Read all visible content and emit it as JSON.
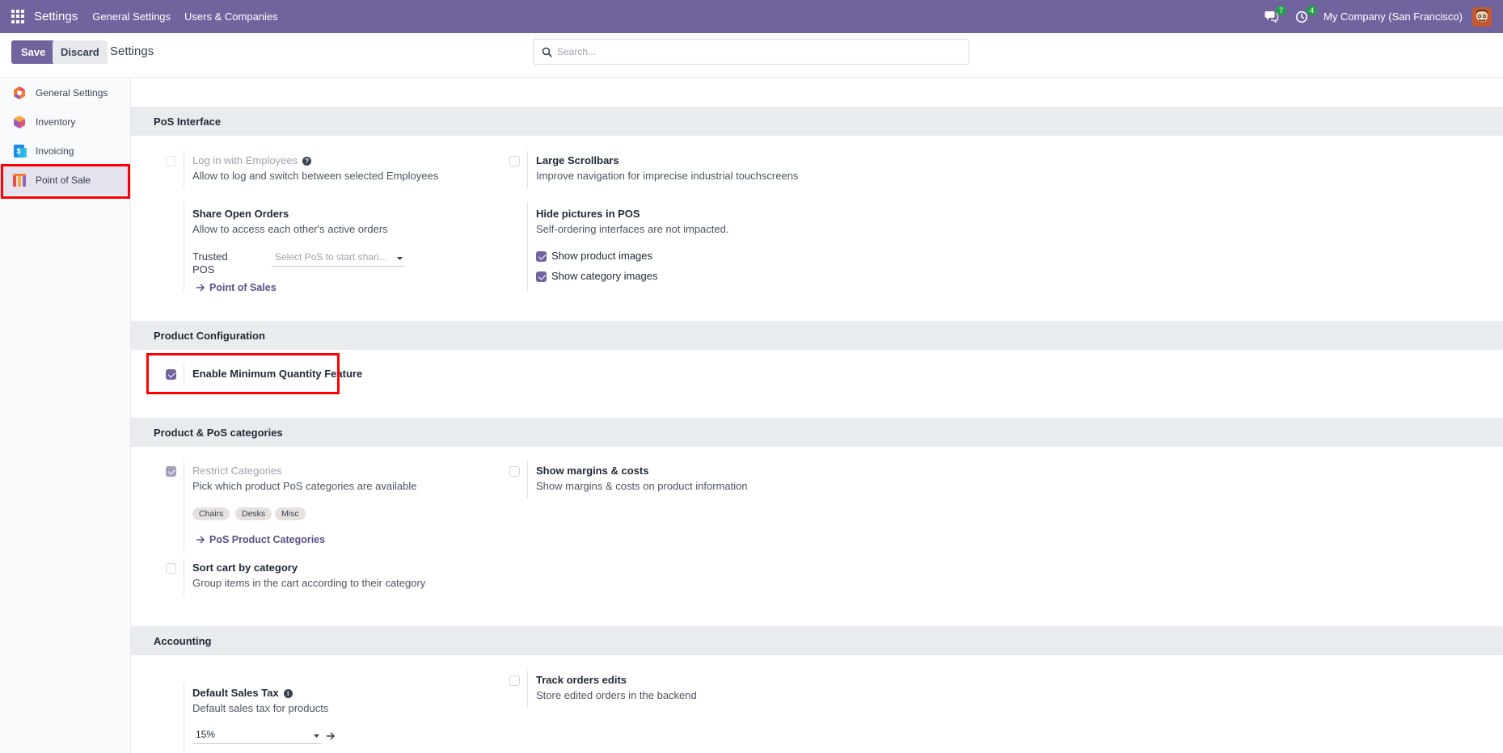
{
  "topnav": {
    "app_title": "Settings",
    "menu": [
      "General Settings",
      "Users & Companies"
    ],
    "messages_badge": "7",
    "activities_badge": "4",
    "company": "My Company (San Francisco)"
  },
  "controlbar": {
    "save_label": "Save",
    "discard_label": "Discard",
    "title": "Settings",
    "search_placeholder": "Search..."
  },
  "sidebar": {
    "items": [
      {
        "label": "General Settings",
        "icon": "general-settings-icon"
      },
      {
        "label": "Inventory",
        "icon": "inventory-icon"
      },
      {
        "label": "Invoicing",
        "icon": "invoicing-icon"
      },
      {
        "label": "Point of Sale",
        "icon": "point-of-sale-icon",
        "active": true
      }
    ]
  },
  "sections": {
    "pos_interface": {
      "title": "PoS Interface",
      "login_employees": {
        "label": "Log in with Employees",
        "desc": "Allow to log and switch between selected Employees",
        "checked": false
      },
      "large_scrollbars": {
        "label": "Large Scrollbars",
        "desc": "Improve navigation for imprecise industrial touchscreens",
        "checked": false
      },
      "share_orders": {
        "label": "Share Open Orders",
        "desc": "Allow to access each other's active orders",
        "trusted_label_1": "Trusted",
        "trusted_label_2": "POS",
        "trusted_placeholder": "Select PoS to start shari...",
        "link": "Point of Sales"
      },
      "hide_pictures": {
        "label": "Hide pictures in POS",
        "desc": "Self-ordering interfaces are not impacted.",
        "show_product_images": "Show product images",
        "show_category_images": "Show category images"
      }
    },
    "product_config": {
      "title": "Product Configuration",
      "min_qty": {
        "label": "Enable Minimum Quantity Feature",
        "checked": true
      }
    },
    "categories": {
      "title": "Product & PoS categories",
      "restrict": {
        "label": "Restrict Categories",
        "desc": "Pick which product PoS categories are available",
        "tags": [
          "Chairs",
          "Desks",
          "Misc"
        ],
        "link": "PoS Product Categories",
        "checked": true
      },
      "margins": {
        "label": "Show margins & costs",
        "desc": "Show margins & costs on product information",
        "checked": false
      },
      "sort_cart": {
        "label": "Sort cart by category",
        "desc": "Group items in the cart according to their category",
        "checked": false
      }
    },
    "accounting": {
      "title": "Accounting",
      "tax": {
        "label": "Default Sales Tax",
        "desc": "Default sales tax for products",
        "value": "15%"
      },
      "track": {
        "label": "Track orders edits",
        "desc": "Store edited orders in the backend",
        "checked": false
      }
    }
  },
  "colors": {
    "brand": "#71639e",
    "highlight": "#ff0000",
    "badge": "#22a04b"
  }
}
